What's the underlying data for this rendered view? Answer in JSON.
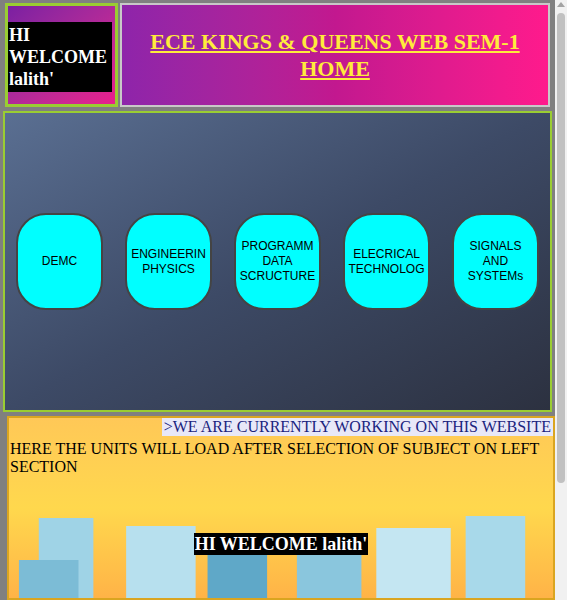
{
  "header": {
    "greeting": "HI WELCOME lalith'",
    "title": "ECE KINGS & QUEENS WEB SEM-1 HOME"
  },
  "subjects": [
    {
      "lines": [
        "DEMC"
      ]
    },
    {
      "lines": [
        "ENGINEERIN",
        "PHYSICS"
      ]
    },
    {
      "lines": [
        "PROGRAMM",
        "DATA",
        "SCRUCTURE"
      ]
    },
    {
      "lines": [
        "ELECRICAL",
        "TECHNOLOG"
      ]
    },
    {
      "lines": [
        "SIGNALS",
        "AND",
        "SYSTEMs"
      ]
    }
  ],
  "notice": ">WE ARE CURRENTLY WORKING ON THIS WEBSITE",
  "placeholder": "HERE THE UNITS WILL LOAD AFTER SELECTION OF SUBJECT ON LEFT SECTION",
  "welcome": "HI WELCOME lalith'"
}
